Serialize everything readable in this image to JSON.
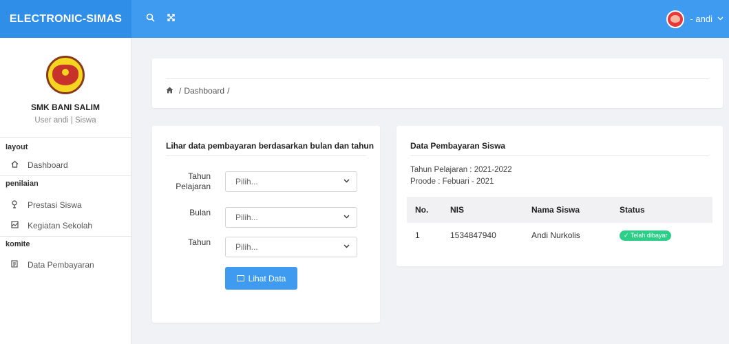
{
  "app": {
    "title": "ELECTRONIC-SIMAS"
  },
  "topbar": {
    "search_icon": "search-icon",
    "fullscreen_icon": "expand-icon",
    "user_label": "- andi",
    "chevron": "⌄"
  },
  "sidebar": {
    "school_name": "SMK BANI SALIM",
    "user_role": "User andi | Siswa",
    "sections": [
      {
        "title": "layout",
        "items": [
          {
            "label": "Dashboard",
            "icon": "home-icon"
          }
        ]
      },
      {
        "title": "penilaian",
        "items": [
          {
            "label": "Prestasi Siswa",
            "icon": "trophy-icon"
          },
          {
            "label": "Kegiatan Sekolah",
            "icon": "image-icon"
          }
        ]
      },
      {
        "title": "komite",
        "items": [
          {
            "label": "Data Pembayaran",
            "icon": "document-icon"
          }
        ]
      }
    ]
  },
  "breadcrumb": {
    "items": [
      "Dashboard"
    ],
    "separator": "/"
  },
  "filter_form": {
    "title": "Lihar data pembayaran berdasarkan bulan dan tahun",
    "fields": [
      {
        "label": "Tahun Pelajaran",
        "value": "Pilih..."
      },
      {
        "label": "Bulan",
        "value": "Pilih..."
      },
      {
        "label": "Tahun",
        "value": "Pilih..."
      }
    ],
    "submit_label": "Lihat Data"
  },
  "payments": {
    "title": "Data Pembayaran Siswa",
    "tahun_pelajaran": "Tahun Pelajaran : 2021-2022",
    "periode": "Proode : Febuari - 2021",
    "columns": [
      "No.",
      "NIS",
      "Nama Siswa",
      "Status"
    ],
    "rows": [
      {
        "no": "1",
        "nis": "1534847940",
        "nama": "Andi Nurkolis",
        "status": "✓ Telah dibayar"
      }
    ]
  },
  "colors": {
    "primary": "#3f9bef",
    "success": "#2bcf87",
    "background": "#f1f2f6"
  }
}
